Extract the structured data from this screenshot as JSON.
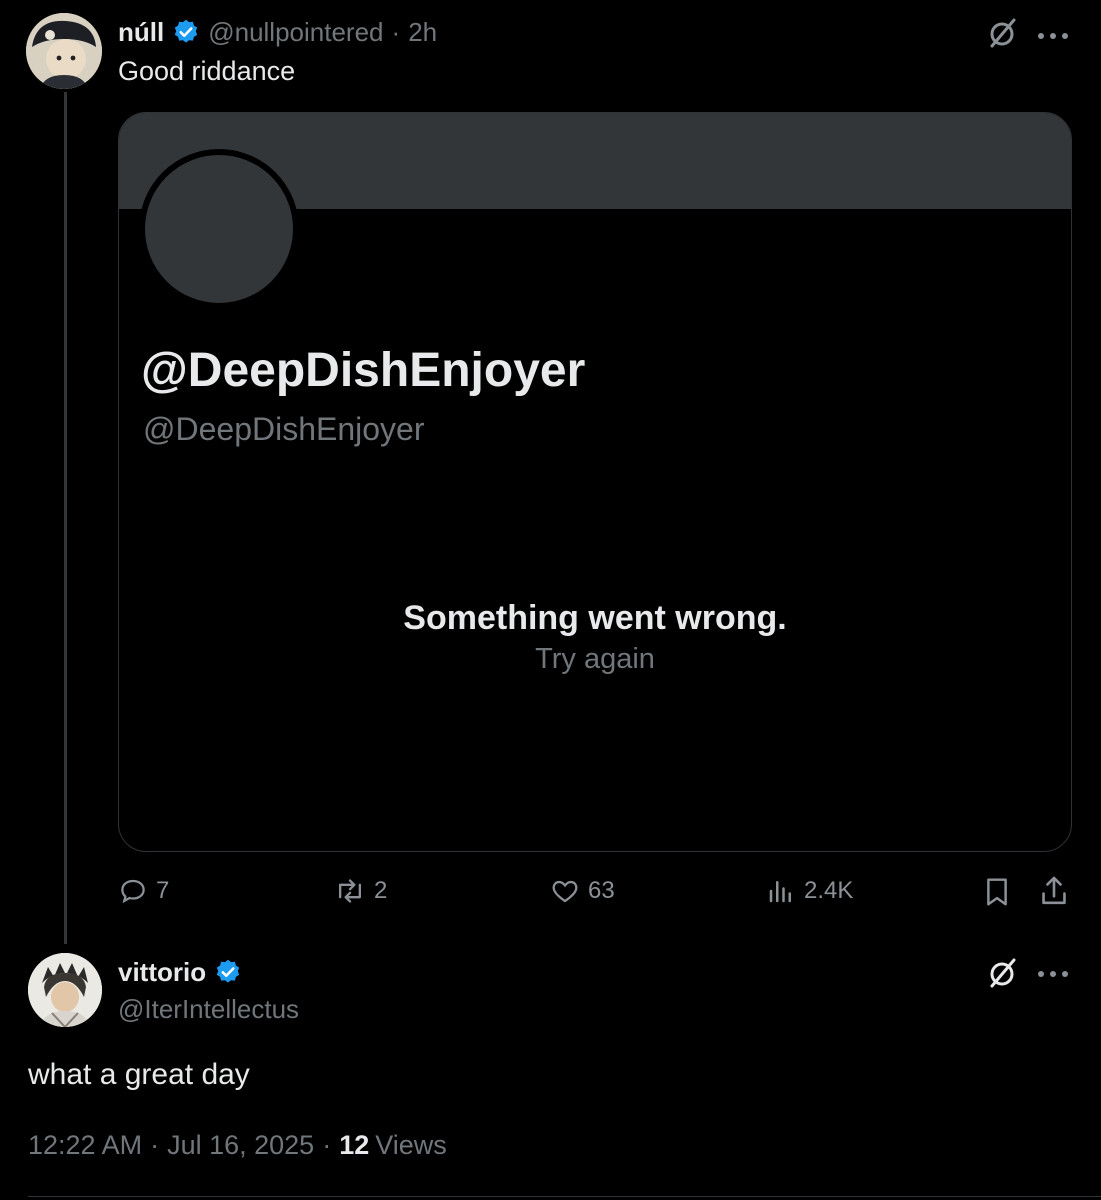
{
  "tweet1": {
    "display_name": "núll",
    "handle": "@nullpointered",
    "separator": "·",
    "time": "2h",
    "text": "Good riddance",
    "quoted_card": {
      "title": "@DeepDishEnjoyer",
      "handle": "@DeepDishEnjoyer",
      "error_title": "Something went wrong.",
      "retry": "Try again"
    },
    "actions": {
      "replies": "7",
      "reposts": "2",
      "likes": "63",
      "views": "2.4K"
    }
  },
  "tweet2": {
    "display_name": "vittorio",
    "handle": "@IterIntellectus",
    "text": "what a great day",
    "time": "12:22 AM",
    "dot1": "·",
    "date": "Jul 16, 2025",
    "dot2": "·",
    "views_count": "12",
    "views_label": "Views"
  },
  "colors": {
    "background": "#000000",
    "text": "#e7e9ea",
    "muted": "#71767b",
    "verified": "#1d9bf0",
    "border": "#2f3336"
  }
}
